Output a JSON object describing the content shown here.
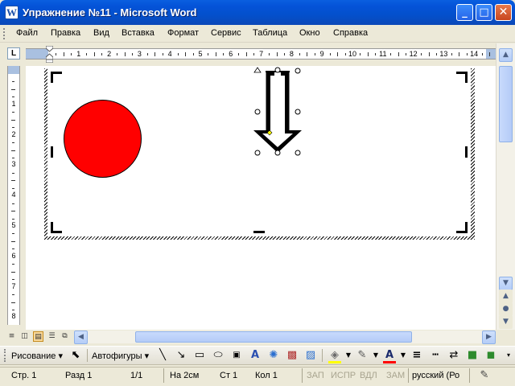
{
  "window": {
    "title": "Упражнение №11 - Microsoft Word",
    "icon": "W",
    "minimize": "_",
    "maximize": "□",
    "close": "✕"
  },
  "menu": [
    "Файл",
    "Правка",
    "Вид",
    "Вставка",
    "Формат",
    "Сервис",
    "Таблица",
    "Окно",
    "Справка"
  ],
  "ruler": {
    "tab_selector": "L",
    "h_numbers": [
      "1",
      "2",
      "3",
      "4",
      "5",
      "6",
      "7",
      "8",
      "9",
      "10",
      "11",
      "12",
      "13",
      "14"
    ],
    "v_numbers": [
      "1",
      "2",
      "3",
      "4",
      "5",
      "6",
      "7",
      "8"
    ]
  },
  "document": {
    "shapes": [
      {
        "type": "circle",
        "fill": "#ff0000"
      },
      {
        "type": "down-arrow",
        "selected": true
      }
    ],
    "canvas": "drawing-canvas"
  },
  "drawing_toolbar": {
    "draw_label": "Рисование",
    "autoshapes_label": "Автофигуры",
    "icons": [
      "line-icon",
      "arrow-icon",
      "rectangle-icon",
      "oval-icon",
      "textbox-icon",
      "wordart-icon",
      "diagram-icon",
      "clipart-icon",
      "picture-icon",
      "fill-color-icon",
      "line-color-icon",
      "font-color-icon",
      "line-style-icon",
      "dash-style-icon",
      "arrow-style-icon",
      "shadow-icon",
      "3d-icon"
    ]
  },
  "status": {
    "page": "Стр. 1",
    "section": "Разд 1",
    "pages": "1/1",
    "at": "На 2см",
    "line": "Ст 1",
    "col": "Кол 1",
    "rec": "ЗАП",
    "trk": "ИСПР",
    "ext": "ВДЛ",
    "ovr": "ЗАМ",
    "language": "русский (Ро"
  },
  "colors": {
    "title_bar": "#0453d8",
    "circle_fill": "#ff0000",
    "font_color": "#ff0000",
    "fill_color": "#ffff00"
  }
}
